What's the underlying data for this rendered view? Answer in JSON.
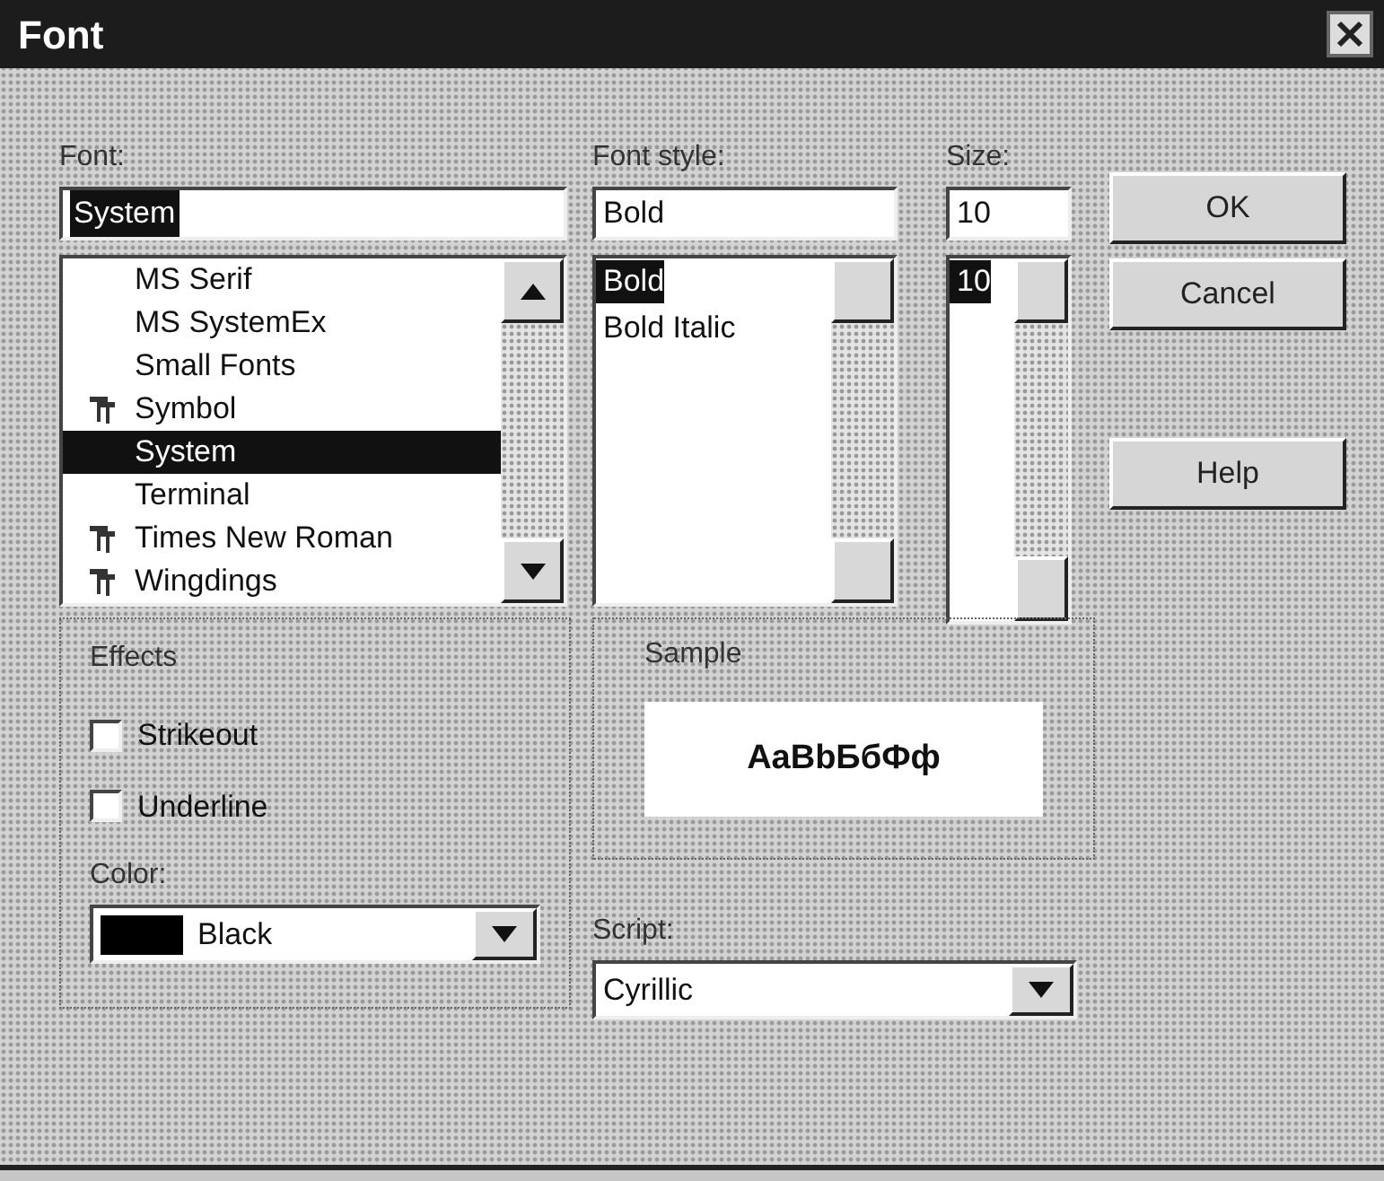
{
  "window": {
    "title": "Font"
  },
  "font": {
    "label": "Font:",
    "value": "System",
    "items": [
      {
        "label": "MS Serif",
        "truetype": false,
        "selected": false
      },
      {
        "label": "MS SystemEx",
        "truetype": false,
        "selected": false
      },
      {
        "label": "Small Fonts",
        "truetype": false,
        "selected": false
      },
      {
        "label": "Symbol",
        "truetype": true,
        "selected": false
      },
      {
        "label": "System",
        "truetype": false,
        "selected": true
      },
      {
        "label": "Terminal",
        "truetype": false,
        "selected": false
      },
      {
        "label": "Times New Roman",
        "truetype": true,
        "selected": false
      },
      {
        "label": "Wingdings",
        "truetype": true,
        "selected": false
      }
    ]
  },
  "font_style": {
    "label": "Font style:",
    "value": "Bold",
    "items": [
      {
        "label": "Bold",
        "selected": true
      },
      {
        "label": "Bold Italic",
        "selected": false
      }
    ]
  },
  "size": {
    "label": "Size:",
    "value": "10",
    "items": [
      {
        "label": "10",
        "selected": true
      }
    ]
  },
  "buttons": [
    "OK",
    "Cancel",
    "Help"
  ],
  "effects": {
    "label": "Effects",
    "checkboxes": [
      {
        "label": "Strikeout",
        "checked": false
      },
      {
        "label": "Underline",
        "checked": false
      }
    ],
    "color_label": "Color:",
    "color_value": "Black"
  },
  "sample": {
    "label": "Sample",
    "text": "AaBbБбФф"
  },
  "script": {
    "label": "Script:",
    "value": "Cyrillic"
  }
}
